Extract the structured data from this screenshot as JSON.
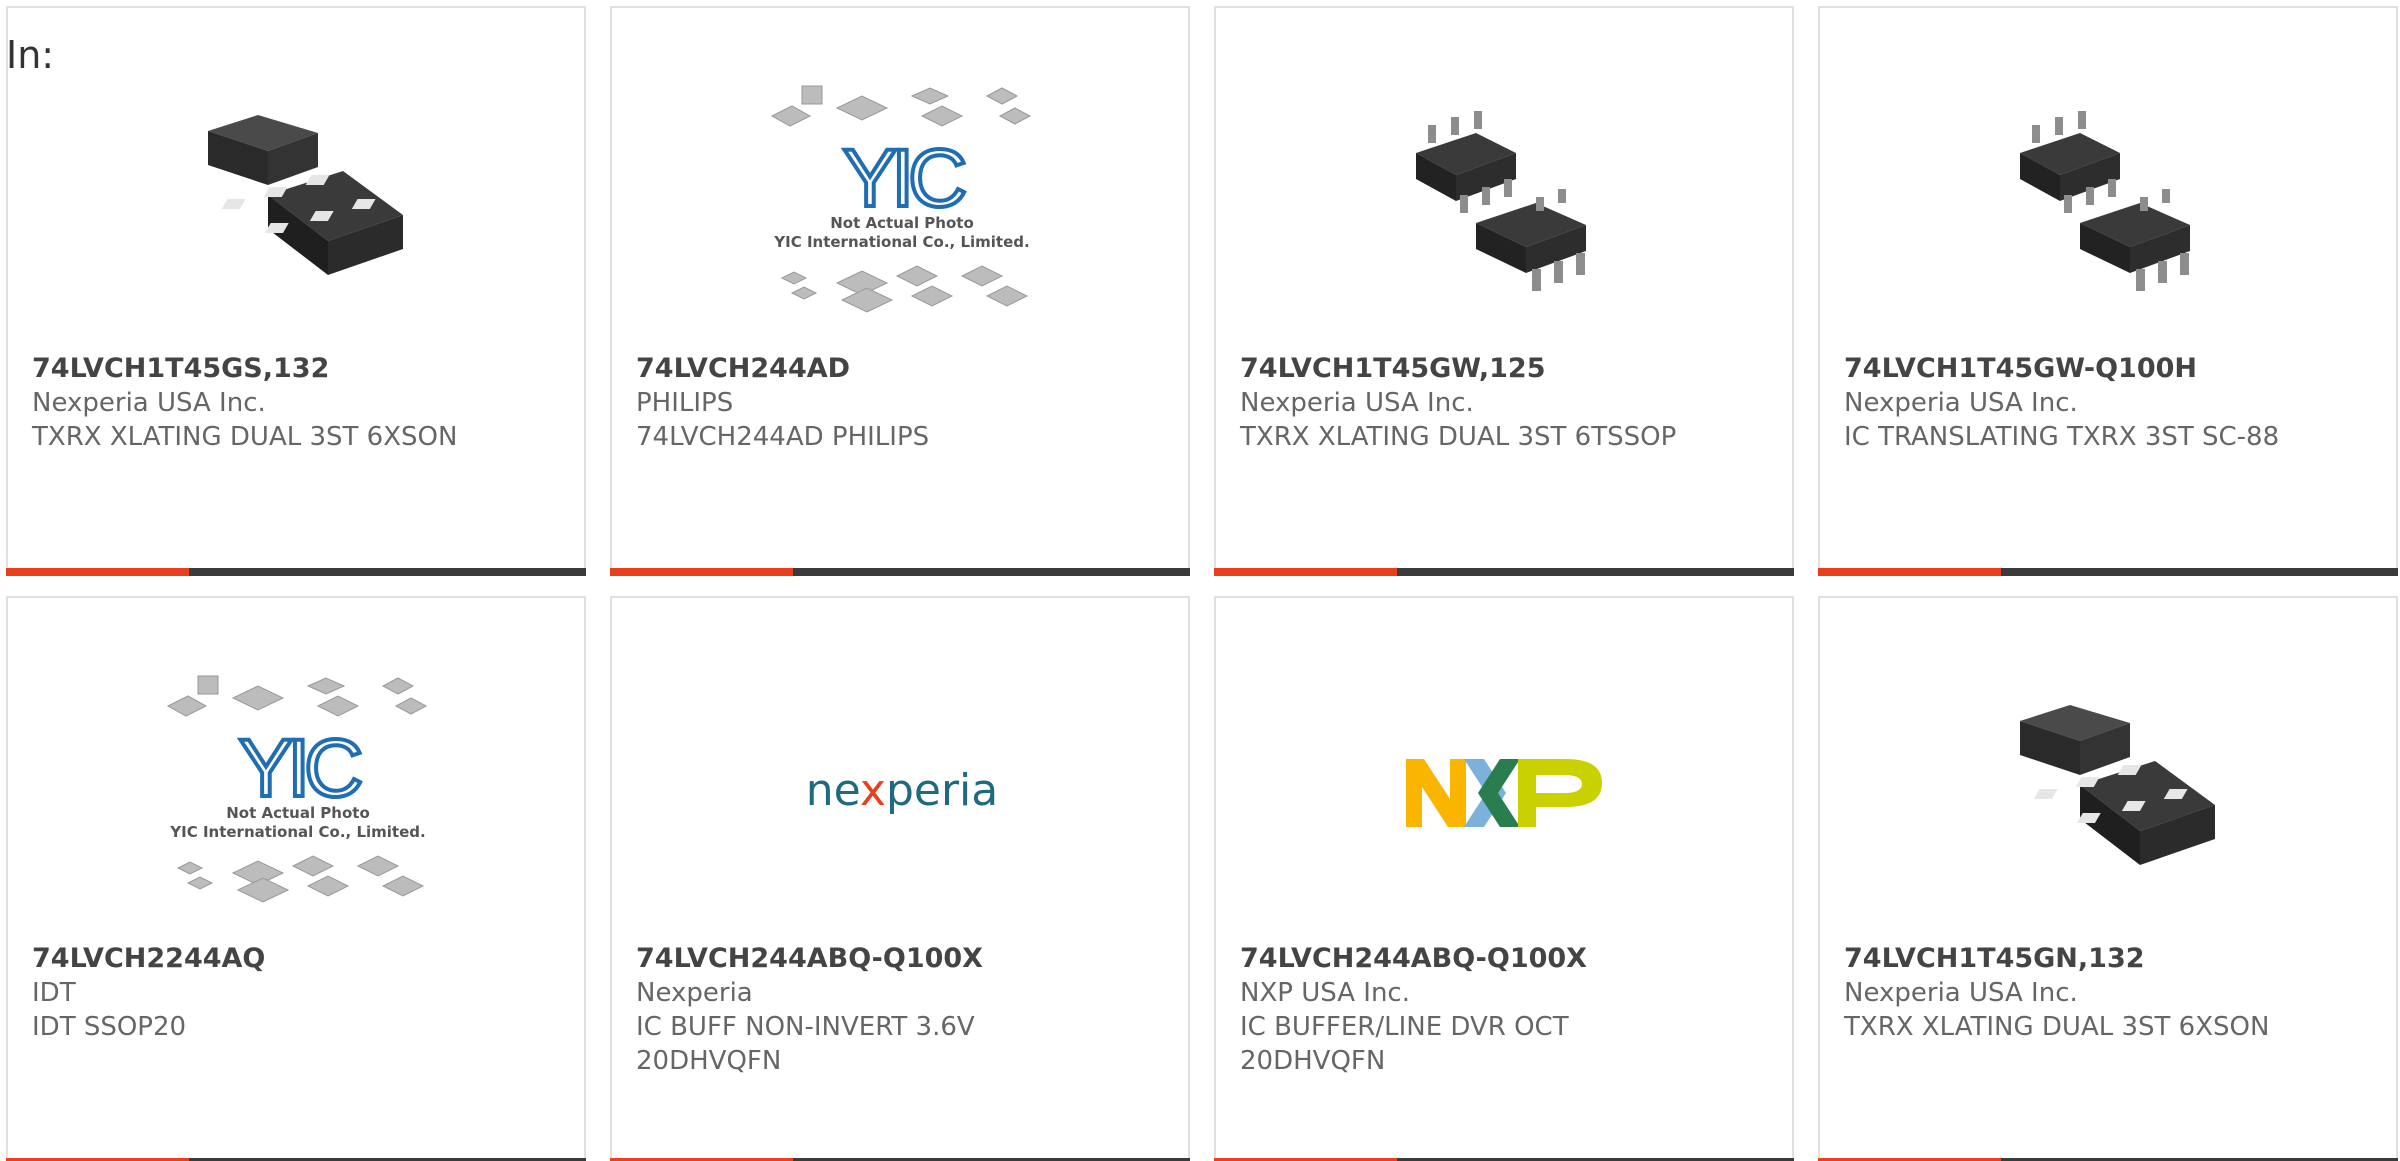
{
  "header": {
    "in_label": "In:"
  },
  "colors": {
    "accent": "#e8401c",
    "bar": "#3b3b3b",
    "border": "#e0e0e0"
  },
  "products": [
    {
      "part_number": "74LVCH1T45GS,132",
      "manufacturer": "Nexperia USA Inc.",
      "description": "TXRX XLATING DUAL 3ST 6XSON",
      "image": "xson-package-icon"
    },
    {
      "part_number": "74LVCH244AD",
      "manufacturer": "PHILIPS",
      "description": "74LVCH244AD PHILIPS",
      "image": "yic-placeholder-icon"
    },
    {
      "part_number": "74LVCH1T45GW,125",
      "manufacturer": "Nexperia USA Inc.",
      "description": "TXRX XLATING DUAL 3ST 6TSSOP",
      "image": "tssop-package-icon"
    },
    {
      "part_number": "74LVCH1T45GW-Q100H",
      "manufacturer": "Nexperia USA Inc.",
      "description": "IC TRANSLATING TXRX 3ST SC-88",
      "image": "tssop-package-icon"
    },
    {
      "part_number": "74LVCH2244AQ",
      "manufacturer": "IDT",
      "description": "IDT SSOP20",
      "image": "yic-placeholder-icon"
    },
    {
      "part_number": "74LVCH244ABQ-Q100X",
      "manufacturer": "Nexperia",
      "description": "IC BUFF NON-INVERT 3.6V 20DHVQFN",
      "image": "nexperia-logo"
    },
    {
      "part_number": "74LVCH244ABQ-Q100X",
      "manufacturer": "NXP USA Inc.",
      "description": "IC BUFFER/LINE DVR OCT 20DHVQFN",
      "image": "nxp-logo"
    },
    {
      "part_number": "74LVCH1T45GN,132",
      "manufacturer": "Nexperia USA Inc.",
      "description": "TXRX XLATING DUAL 3ST 6XSON",
      "image": "xson-package-icon"
    }
  ],
  "yic": {
    "line1": "Not Actual Photo",
    "line2": "YIC International Co., Limited."
  },
  "logos": {
    "nexperia_pre": "ne",
    "nexperia_x": "x",
    "nexperia_post": "peria"
  }
}
